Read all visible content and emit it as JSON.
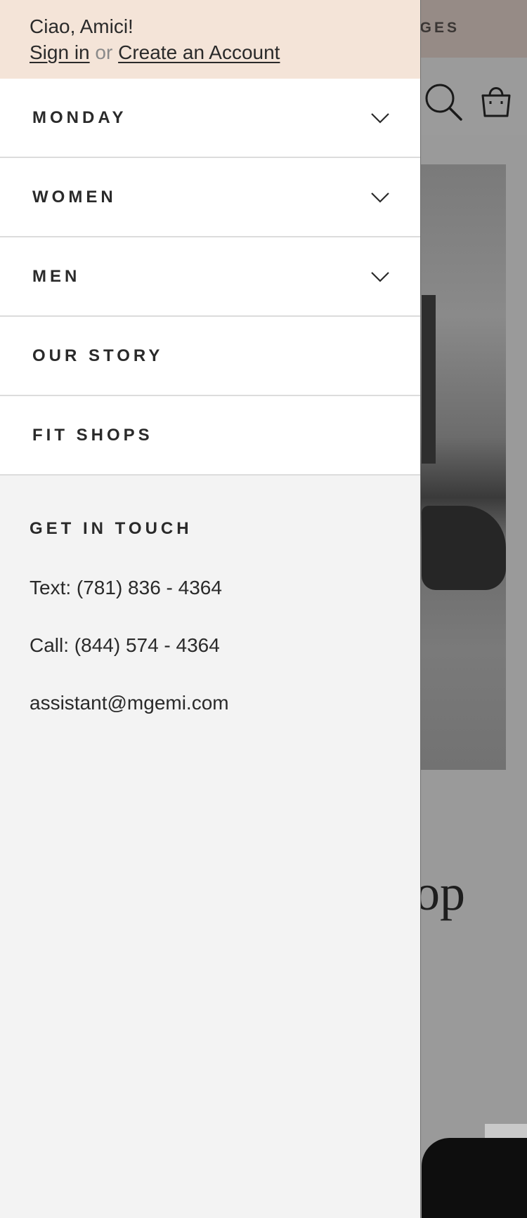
{
  "background": {
    "banner_text": "GES",
    "heading_fragment": "op",
    "icons": [
      "search-icon",
      "shopping-bag-icon"
    ]
  },
  "drawer": {
    "greeting": "Ciao, Amici!",
    "sign_in": "Sign in",
    "or": "or",
    "create_account": "Create an Account",
    "nav_items": [
      {
        "label": "MONDAY",
        "expandable": true
      },
      {
        "label": "WOMEN",
        "expandable": true
      },
      {
        "label": "MEN",
        "expandable": true
      },
      {
        "label": "OUR STORY",
        "expandable": false
      },
      {
        "label": "FIT SHOPS",
        "expandable": false
      }
    ],
    "contact": {
      "title": "GET IN TOUCH",
      "text": "Text: (781) 836 - 4364",
      "call": "Call: (844) 574 - 4364",
      "email": "assistant@mgemi.com"
    }
  },
  "colors": {
    "account_bg": "#f4e4d8",
    "drawer_bg": "#f3f3f3",
    "text": "#2a2a2a",
    "overlay": "#9a9a9a"
  }
}
